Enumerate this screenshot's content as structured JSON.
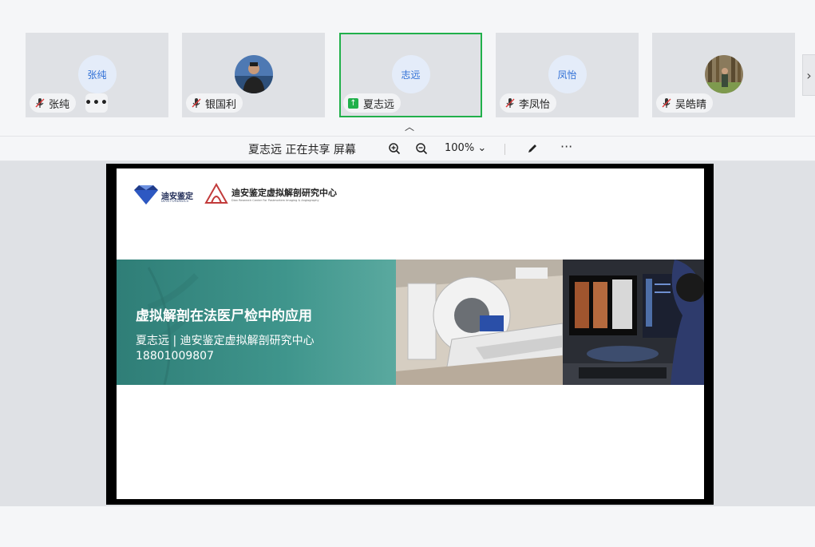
{
  "participants": [
    {
      "avatar_text": "张纯",
      "name": "张纯",
      "has_more": true,
      "more_label": "•••"
    },
    {
      "avatar_text": "",
      "name": "银国利",
      "photo": true
    },
    {
      "avatar_text": "志远",
      "name": "夏志远",
      "sharing": true,
      "share_icon": "↑"
    },
    {
      "avatar_text": "凤怡",
      "name": "李凤怡"
    },
    {
      "avatar_text": "",
      "name": "吴皓晴",
      "photo": true
    }
  ],
  "strip": {
    "next_icon": "›",
    "collapse_icon": "︿"
  },
  "toolbar": {
    "share_status": "夏志远 正在共享 屏幕",
    "zoom": "100%",
    "zoom_caret": "⌄",
    "more": "···"
  },
  "slide": {
    "logo1_text": "迪安鉴定",
    "logo1_sub": "DIAN FORENSICS",
    "logo2_text": "迪安鉴定虚拟解剖研究中心",
    "logo2_sub": "Dian Research Center For Postmortem Imaging & Angiography",
    "title": "虚拟解剖在法医尸检中的应用",
    "subtitle": "夏志远 | 迪安鉴定虚拟解剖研究中心",
    "phone": "18801009807"
  },
  "colors": {
    "active_border": "#21b04b",
    "banner": "#3f958c",
    "avatar_text": "#2f6fd6"
  }
}
